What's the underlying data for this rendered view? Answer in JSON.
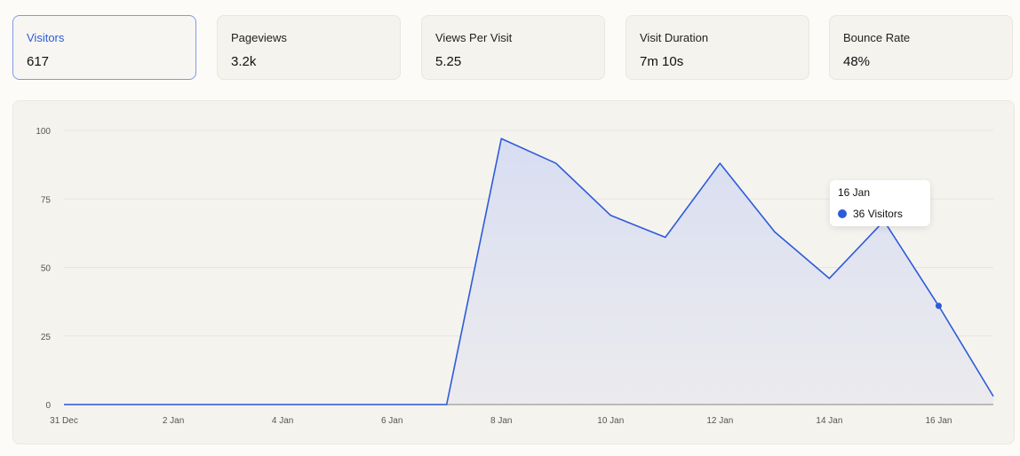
{
  "stats": [
    {
      "label": "Visitors",
      "value": "617",
      "active": true
    },
    {
      "label": "Pageviews",
      "value": "3.2k",
      "active": false
    },
    {
      "label": "Views Per Visit",
      "value": "5.25",
      "active": false
    },
    {
      "label": "Visit Duration",
      "value": "7m 10s",
      "active": false
    },
    {
      "label": "Bounce Rate",
      "value": "48%",
      "active": false
    }
  ],
  "tooltip": {
    "date": "16 Jan",
    "value": "36",
    "unit": "Visitors"
  },
  "colors": {
    "accent": "#2d5bd8",
    "fill": "#dde2f3",
    "grid": "#e8e5de",
    "baseline": "#9a9a9a"
  },
  "chart_data": {
    "type": "area",
    "x": [
      "31 Dec",
      "1 Jan",
      "2 Jan",
      "3 Jan",
      "4 Jan",
      "5 Jan",
      "6 Jan",
      "7 Jan",
      "8 Jan",
      "9 Jan",
      "10 Jan",
      "11 Jan",
      "12 Jan",
      "13 Jan",
      "14 Jan",
      "15 Jan",
      "16 Jan",
      "17 Jan"
    ],
    "series": [
      {
        "name": "Visitors",
        "values": [
          0,
          0,
          0,
          0,
          0,
          0,
          0,
          0,
          97,
          88,
          69,
          61,
          88,
          63,
          46,
          67,
          36,
          3
        ]
      }
    ],
    "x_tick_labels": [
      "31 Dec",
      "2 Jan",
      "4 Jan",
      "6 Jan",
      "8 Jan",
      "10 Jan",
      "12 Jan",
      "14 Jan",
      "16 Jan"
    ],
    "y_ticks": [
      0,
      25,
      50,
      75,
      100
    ],
    "ylim": [
      0,
      100
    ],
    "grid": true,
    "highlighted_point": "16 Jan"
  }
}
